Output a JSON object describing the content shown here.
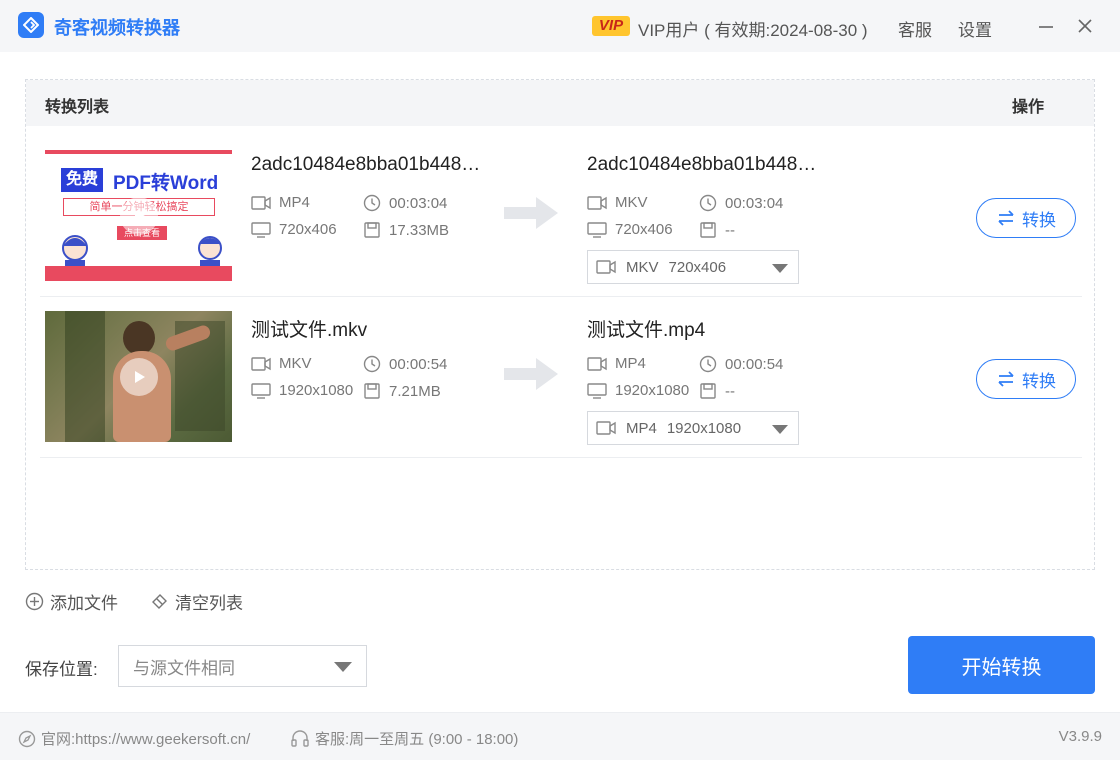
{
  "titlebar": {
    "app_title": "奇客视频转换器",
    "vip_badge": "VIP",
    "vip_text": "VIP用户 ( 有效期:2024-08-30 )",
    "support": "客服",
    "settings": "设置"
  },
  "list": {
    "header_left": "转换列表",
    "header_right": "操作",
    "rows": [
      {
        "thumb_banner_badge": "免费",
        "thumb_banner_title": "PDF转Word",
        "thumb_banner_sub": "简单一分钟轻松搞定",
        "thumb_banner_btn": "点击查看",
        "source": {
          "name": "2adc10484e8bba01b448…",
          "format": "MP4",
          "duration": "00:03:04",
          "resolution": "720x406",
          "size": "17.33MB"
        },
        "target": {
          "name": "2adc10484e8bba01b448…",
          "format": "MKV",
          "duration": "00:03:04",
          "resolution": "720x406",
          "size": "--"
        },
        "select_format": "MKV",
        "select_resolution": "720x406",
        "convert_label": "转换"
      },
      {
        "source": {
          "name": "测试文件.mkv",
          "format": "MKV",
          "duration": "00:00:54",
          "resolution": "1920x1080",
          "size": "7.21MB"
        },
        "target": {
          "name": "测试文件.mp4",
          "format": "MP4",
          "duration": "00:00:54",
          "resolution": "1920x1080",
          "size": "--"
        },
        "select_format": "MP4",
        "select_resolution": "1920x1080",
        "convert_label": "转换"
      }
    ]
  },
  "toolbar": {
    "add_file": "添加文件",
    "clear_list": "清空列表"
  },
  "save": {
    "label": "保存位置:",
    "value": "与源文件相同"
  },
  "start_button": "开始转换",
  "footer": {
    "website": "官网:https://www.geekersoft.cn/",
    "service": "客服:周一至周五 (9:00 - 18:00)",
    "version": "V3.9.9"
  },
  "colors": {
    "accent": "#2f7df6",
    "vip_gold": "#ffc52e"
  }
}
